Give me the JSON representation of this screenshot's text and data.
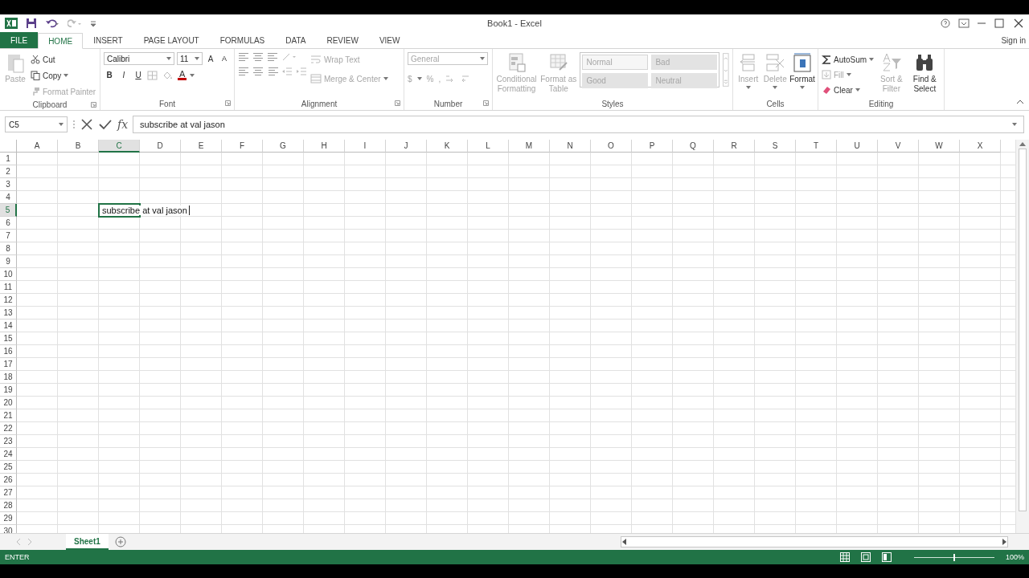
{
  "window": {
    "title": "Book1 - Excel",
    "sign_in": "Sign in"
  },
  "tabs": [
    {
      "label": "FILE",
      "kind": "file",
      "selected": false
    },
    {
      "label": "HOME",
      "kind": "tab",
      "selected": true
    },
    {
      "label": "INSERT",
      "kind": "tab",
      "selected": false
    },
    {
      "label": "PAGE LAYOUT",
      "kind": "tab",
      "selected": false
    },
    {
      "label": "FORMULAS",
      "kind": "tab",
      "selected": false
    },
    {
      "label": "DATA",
      "kind": "tab",
      "selected": false
    },
    {
      "label": "REVIEW",
      "kind": "tab",
      "selected": false
    },
    {
      "label": "VIEW",
      "kind": "tab",
      "selected": false
    }
  ],
  "clipboard": {
    "label": "Clipboard",
    "paste": {
      "label": "Paste",
      "disabled": true
    },
    "actions": [
      {
        "label": "Cut",
        "disabled": false,
        "dropdown": false
      },
      {
        "label": "Copy",
        "disabled": false,
        "dropdown": true
      },
      {
        "label": "Format Painter",
        "disabled": true,
        "dropdown": false
      }
    ]
  },
  "font": {
    "label": "Font",
    "face": "Calibri",
    "size": "11",
    "grow": "A",
    "shrink": "A",
    "styles": [
      "B",
      "I",
      "U"
    ],
    "color_letter": "A"
  },
  "alignment": {
    "label": "Alignment",
    "wrap": {
      "label": "Wrap Text",
      "disabled": true
    },
    "merge": {
      "label": "Merge & Center",
      "disabled": true
    }
  },
  "number": {
    "label": "Number",
    "format": "General",
    "currency": "$",
    "percent": "%",
    "comma": ","
  },
  "styles": {
    "label": "Styles",
    "conditional": {
      "label": "Conditional Formatting",
      "disabled": true
    },
    "format_table": {
      "label": "Format as Table",
      "disabled": true
    },
    "gallery": [
      {
        "label": "Normal",
        "selected": true
      },
      {
        "label": "Bad",
        "selected": false
      },
      {
        "label": "Good",
        "selected": false
      },
      {
        "label": "Neutral",
        "selected": false
      }
    ]
  },
  "cells": {
    "label": "Cells",
    "buttons": [
      {
        "label": "Insert",
        "kind": "insert",
        "disabled": true
      },
      {
        "label": "Delete",
        "kind": "delete",
        "disabled": true
      },
      {
        "label": "Format",
        "kind": "format",
        "disabled": false
      }
    ]
  },
  "editing": {
    "label": "Editing",
    "autosum": {
      "label": "AutoSum",
      "disabled": false
    },
    "fill": {
      "label": "Fill",
      "disabled": true
    },
    "clear": {
      "label": "Clear",
      "disabled": false
    },
    "sort": {
      "label": "Sort & Filter",
      "disabled": true
    },
    "find": {
      "label": "Find & Select",
      "disabled": false
    }
  },
  "formula_bar": {
    "name_box": "C5",
    "fx": "fx",
    "formula": "subscribe at val jason"
  },
  "grid": {
    "columns": [
      {
        "label": "A",
        "selected": false
      },
      {
        "label": "B",
        "selected": false
      },
      {
        "label": "C",
        "selected": true
      },
      {
        "label": "D",
        "selected": false
      },
      {
        "label": "E",
        "selected": false
      },
      {
        "label": "F",
        "selected": false
      },
      {
        "label": "G",
        "selected": false
      },
      {
        "label": "H",
        "selected": false
      },
      {
        "label": "I",
        "selected": false
      },
      {
        "label": "J",
        "selected": false
      },
      {
        "label": "K",
        "selected": false
      },
      {
        "label": "L",
        "selected": false
      },
      {
        "label": "M",
        "selected": false
      },
      {
        "label": "N",
        "selected": false
      },
      {
        "label": "O",
        "selected": false
      },
      {
        "label": "P",
        "selected": false
      },
      {
        "label": "Q",
        "selected": false
      },
      {
        "label": "R",
        "selected": false
      },
      {
        "label": "S",
        "selected": false
      },
      {
        "label": "T",
        "selected": false
      },
      {
        "label": "U",
        "selected": false
      },
      {
        "label": "V",
        "selected": false
      },
      {
        "label": "W",
        "selected": false
      },
      {
        "label": "X",
        "selected": false
      }
    ],
    "rows": [
      {
        "label": "1",
        "selected": false
      },
      {
        "label": "2",
        "selected": false
      },
      {
        "label": "3",
        "selected": false
      },
      {
        "label": "4",
        "selected": false
      },
      {
        "label": "5",
        "selected": true,
        "editor": "subscribe at val jason"
      },
      {
        "label": "6",
        "selected": false
      },
      {
        "label": "7",
        "selected": false
      },
      {
        "label": "8",
        "selected": false
      },
      {
        "label": "9",
        "selected": false
      },
      {
        "label": "10",
        "selected": false
      },
      {
        "label": "11",
        "selected": false
      },
      {
        "label": "12",
        "selected": false
      },
      {
        "label": "13",
        "selected": false
      },
      {
        "label": "14",
        "selected": false
      },
      {
        "label": "15",
        "selected": false
      },
      {
        "label": "16",
        "selected": false
      },
      {
        "label": "17",
        "selected": false
      },
      {
        "label": "18",
        "selected": false
      },
      {
        "label": "19",
        "selected": false
      },
      {
        "label": "20",
        "selected": false
      },
      {
        "label": "21",
        "selected": false
      },
      {
        "label": "22",
        "selected": false
      },
      {
        "label": "23",
        "selected": false
      },
      {
        "label": "24",
        "selected": false
      },
      {
        "label": "25",
        "selected": false
      },
      {
        "label": "26",
        "selected": false
      },
      {
        "label": "27",
        "selected": false
      },
      {
        "label": "28",
        "selected": false
      },
      {
        "label": "29",
        "selected": false
      },
      {
        "label": "30",
        "selected": false
      }
    ]
  },
  "sheets": [
    {
      "name": "Sheet1",
      "selected": true
    }
  ],
  "status": {
    "mode": "ENTER",
    "zoom": "100%",
    "zoom_slider": {
      "level": 0.5
    }
  }
}
